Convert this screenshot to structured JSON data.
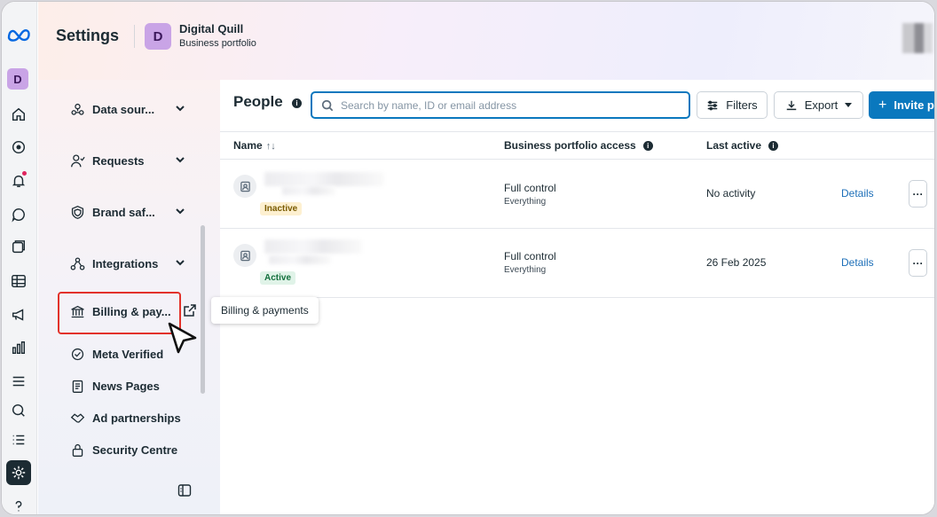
{
  "header": {
    "title": "Settings",
    "portfolio_initial": "D",
    "portfolio_name": "Digital Quill",
    "portfolio_type": "Business portfolio"
  },
  "rail": {
    "avatar_initial": "D",
    "icons": [
      "meta-logo",
      "home-icon",
      "compass-icon",
      "bell-icon",
      "chat-icon",
      "pages-icon",
      "table-icon",
      "megaphone-icon",
      "chart-icon",
      "menu-icon",
      "search-icon",
      "list-icon",
      "gear-icon",
      "help-icon"
    ]
  },
  "sidenav": {
    "items": [
      {
        "label": "Data sour...",
        "icon": "data-sources-icon",
        "expandable": true
      },
      {
        "label": "Requests",
        "icon": "requests-icon",
        "expandable": true
      },
      {
        "label": "Brand saf...",
        "icon": "shield-icon",
        "expandable": true
      },
      {
        "label": "Integrations",
        "icon": "integrations-icon",
        "expandable": true
      },
      {
        "label": "Billing & pay...",
        "icon": "bank-icon",
        "external": true
      },
      {
        "label": "Meta Verified",
        "icon": "verified-icon"
      },
      {
        "label": "News Pages",
        "icon": "news-icon"
      },
      {
        "label": "Ad partnerships",
        "icon": "handshake-icon"
      },
      {
        "label": "Security Centre",
        "icon": "lock-icon"
      }
    ]
  },
  "tooltip": "Billing & payments",
  "main": {
    "title": "People",
    "search_placeholder": "Search by name, ID or email address",
    "filters_label": "Filters",
    "export_label": "Export",
    "invite_label": "Invite pe",
    "columns": {
      "name": "Name",
      "name_sort": "↑↓",
      "access": "Business portfolio access",
      "last_active": "Last active"
    },
    "rows": [
      {
        "status": "Inactive",
        "access": "Full control",
        "access_sub": "Everything",
        "last_active": "No activity",
        "details": "Details",
        "more": "···"
      },
      {
        "status": "Active",
        "access": "Full control",
        "access_sub": "Everything",
        "last_active": "26 Feb 2025",
        "details": "Details",
        "more": "···"
      }
    ]
  },
  "colors": {
    "accent": "#0a78be",
    "highlight": "#e2322b",
    "inactive_badge": "#fdf0d0",
    "active_badge": "#e0f3e8"
  }
}
